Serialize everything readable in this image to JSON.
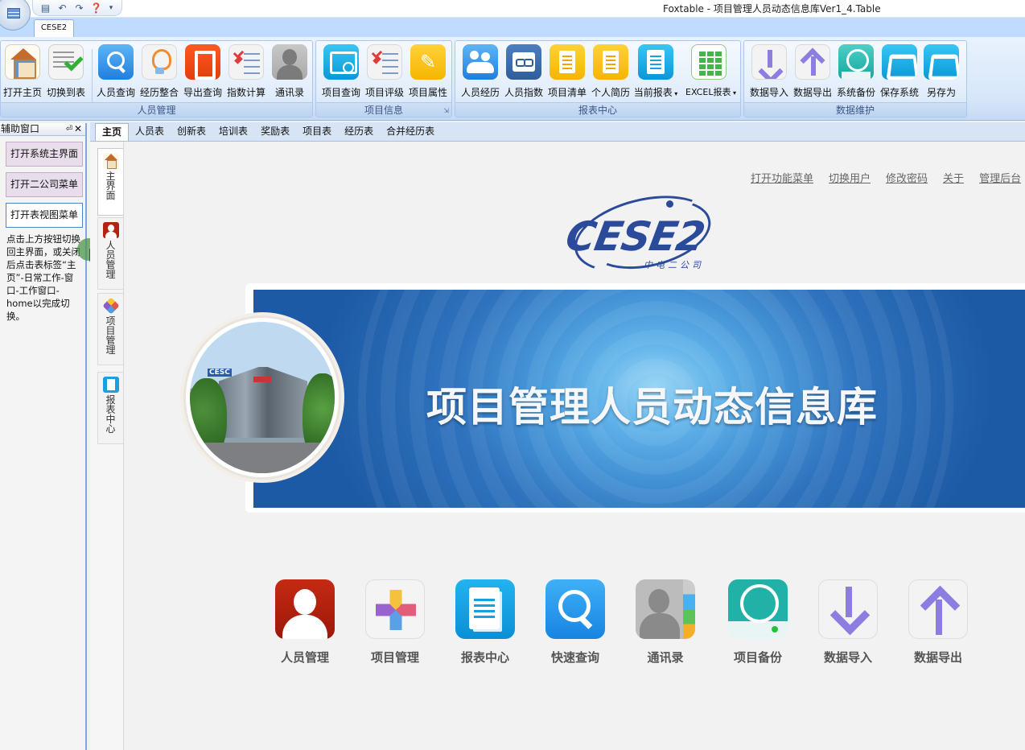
{
  "window": {
    "title": "Foxtable - 项目管理人员动态信息库Ver1_4.Table"
  },
  "ribbon": {
    "tab": "CESE2",
    "groups": [
      {
        "label": "人员管理",
        "buttons": [
          "打开主页",
          "切换到表",
          "人员查询",
          "经历整合",
          "导出查询",
          "指数计算",
          "通讯录"
        ]
      },
      {
        "label": "项目信息",
        "buttons": [
          "项目查询",
          "项目评级",
          "项目属性"
        ]
      },
      {
        "label": "报表中心",
        "buttons": [
          "人员经历",
          "人员指数",
          "项目清单",
          "个人简历",
          "当前报表",
          "EXCEL报表"
        ]
      },
      {
        "label": "数据维护",
        "buttons": [
          "数据导入",
          "数据导出",
          "系统备份",
          "保存系统",
          "另存为"
        ]
      }
    ]
  },
  "side_panel": {
    "title": "辅助窗口",
    "buttons": [
      "打开系统主界面",
      "打开二公司菜单",
      "打开表视图菜单"
    ],
    "note": "点击上方按钮切换回主界面，或关闭后点击表标签“主页”-日常工作-窗口-工作窗口-home以完成切换。"
  },
  "doc_tabs": [
    "主页",
    "人员表",
    "创新表",
    "培训表",
    "奖励表",
    "项目表",
    "经历表",
    "合并经历表"
  ],
  "vnav": [
    "主界面",
    "人员管理",
    "项目管理",
    "报表中心"
  ],
  "main": {
    "links": [
      "打开功能菜单",
      "切换用户",
      "修改密码",
      "关于",
      "管理后台"
    ],
    "logo_text": "CESE2",
    "logo_sub": "中电二公司",
    "photo_sign": "CESC",
    "banner_title": "项目管理人员动态信息库",
    "tiles": [
      "人员管理",
      "项目管理",
      "报表中心",
      "快速查询",
      "通讯录",
      "项目备份",
      "数据导入",
      "数据导出"
    ]
  }
}
